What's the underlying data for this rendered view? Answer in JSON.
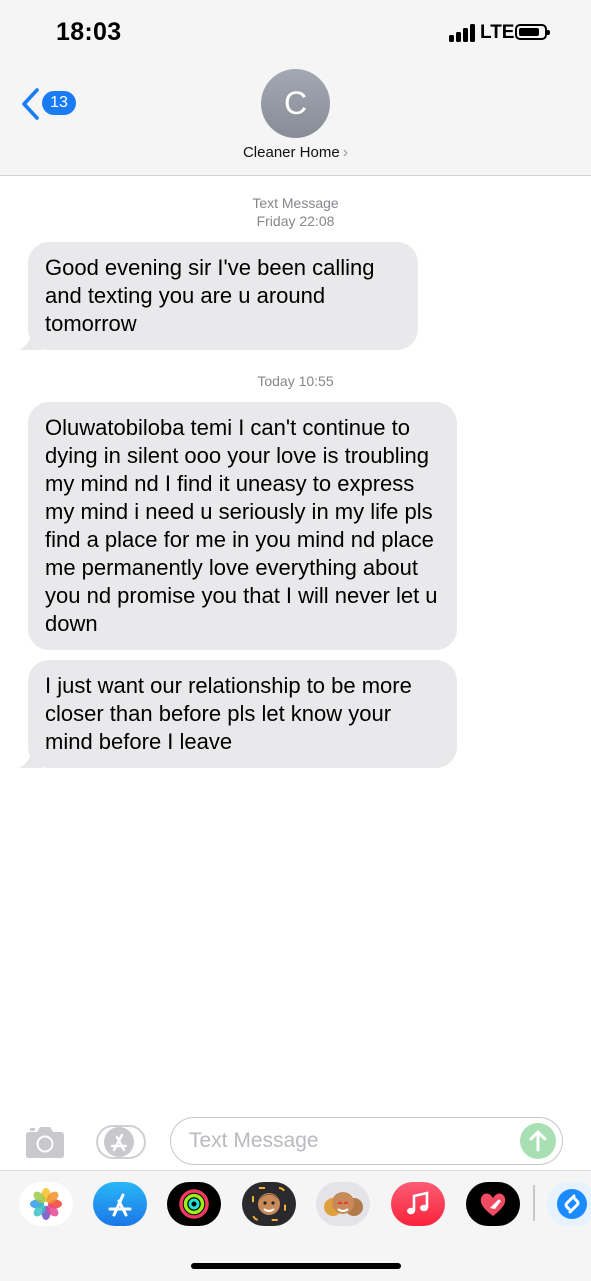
{
  "status_bar": {
    "time": "18:03",
    "network": "LTE",
    "signal_bars": 4,
    "battery_level": 0.85
  },
  "header": {
    "back_badge_count": "13",
    "contact_initial": "C",
    "contact_name": "Cleaner Home",
    "name_chevron": "›"
  },
  "conversation": {
    "header_1_type": "Text Message",
    "header_1_time": "Friday 22:08",
    "messages": [
      {
        "text": "Good evening sir I've been calling and texting you are u around tomorrow"
      },
      {
        "text": "Oluwatobiloba temi I can't continue to dying in silent ooo your love is troubling my mind nd I find it uneasy to express my mind i need u seriously in my life pls find a place for me in you mind nd place me permanently love everything about you nd promise you that I will never let u down"
      },
      {
        "text": "I just want our relationship to be more closer than before pls let know your mind before I leave"
      }
    ],
    "header_2_time": "Today 10:55"
  },
  "input_bar": {
    "placeholder": "Text Message",
    "camera_icon": "camera-icon",
    "apps_icon": "app-store-icon",
    "send_icon": "arrow-up-icon"
  },
  "app_drawer": {
    "apps": [
      {
        "name": "photos-app-icon"
      },
      {
        "name": "app-store-app-icon"
      },
      {
        "name": "activity-app-icon"
      },
      {
        "name": "memoji-app-icon"
      },
      {
        "name": "memoji-stickers-app-icon"
      },
      {
        "name": "music-app-icon"
      },
      {
        "name": "digital-touch-app-icon"
      },
      {
        "name": "shazam-app-icon"
      }
    ]
  },
  "colors": {
    "accent": "#1a7cf5",
    "received_bubble": "#e9e9eb",
    "header_bg": "#f5f5f6",
    "send_button_disabled": "#a8dfb3"
  }
}
